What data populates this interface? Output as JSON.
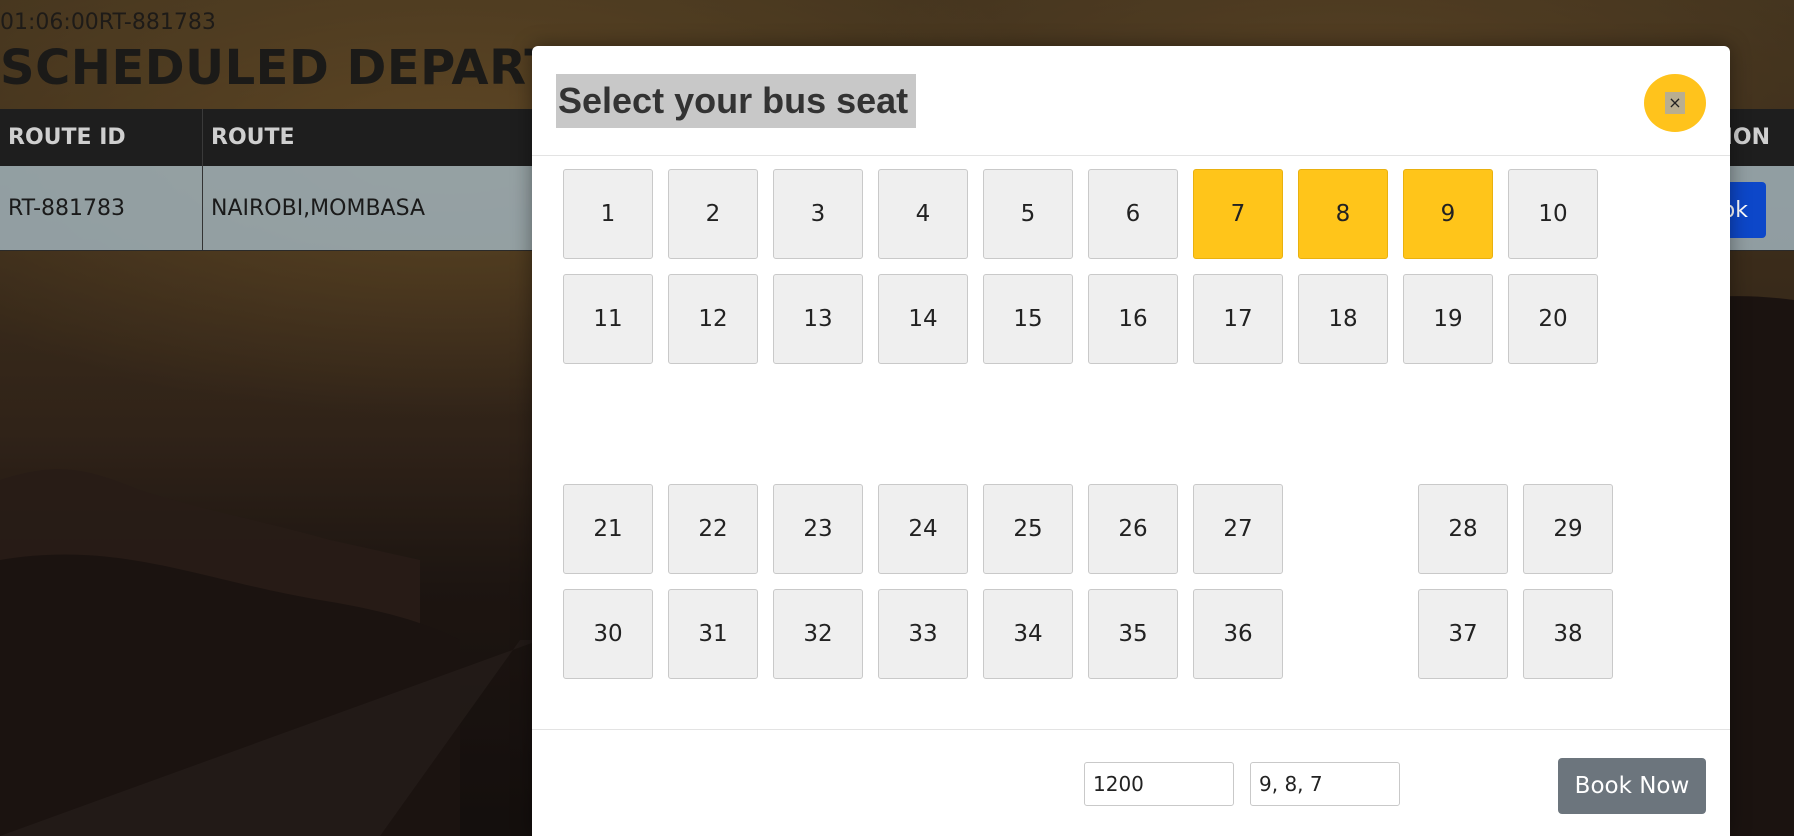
{
  "page": {
    "meta_line": "01:06:00RT-881783",
    "heading": "SCHEDULED DEPARTURES"
  },
  "table": {
    "columns": [
      "ROUTE ID",
      "ROUTE",
      "ACTION"
    ],
    "rows": [
      {
        "route_id": "RT-881783",
        "route": "NAIROBI,MOMBASA",
        "action_label": "Book"
      }
    ]
  },
  "modal": {
    "title": "Select your bus seat",
    "close_label": "×",
    "seats": [
      {
        "number": "1",
        "selected": false
      },
      {
        "number": "2",
        "selected": false
      },
      {
        "number": "3",
        "selected": false
      },
      {
        "number": "4",
        "selected": false
      },
      {
        "number": "5",
        "selected": false
      },
      {
        "number": "6",
        "selected": false
      },
      {
        "number": "7",
        "selected": true
      },
      {
        "number": "8",
        "selected": true
      },
      {
        "number": "9",
        "selected": true
      },
      {
        "number": "10",
        "selected": false
      },
      {
        "number": "11",
        "selected": false
      },
      {
        "number": "12",
        "selected": false
      },
      {
        "number": "13",
        "selected": false
      },
      {
        "number": "14",
        "selected": false
      },
      {
        "number": "15",
        "selected": false
      },
      {
        "number": "16",
        "selected": false
      },
      {
        "number": "17",
        "selected": false
      },
      {
        "number": "18",
        "selected": false
      },
      {
        "number": "19",
        "selected": false
      },
      {
        "number": "20",
        "selected": false
      },
      {
        "number": "21",
        "selected": false
      },
      {
        "number": "22",
        "selected": false
      },
      {
        "number": "23",
        "selected": false
      },
      {
        "number": "24",
        "selected": false
      },
      {
        "number": "25",
        "selected": false
      },
      {
        "number": "26",
        "selected": false
      },
      {
        "number": "27",
        "selected": false
      },
      {
        "number": "28",
        "selected": false
      },
      {
        "number": "29",
        "selected": false
      },
      {
        "number": "30",
        "selected": false
      },
      {
        "number": "31",
        "selected": false
      },
      {
        "number": "32",
        "selected": false
      },
      {
        "number": "33",
        "selected": false
      },
      {
        "number": "34",
        "selected": false
      },
      {
        "number": "35",
        "selected": false
      },
      {
        "number": "36",
        "selected": false
      },
      {
        "number": "37",
        "selected": false
      },
      {
        "number": "38",
        "selected": false
      }
    ],
    "footer": {
      "price_value": "1200",
      "selected_seats_value": "9, 8, 7",
      "book_now_label": "Book Now"
    }
  },
  "colors": {
    "selected_seat": "#ffc51a",
    "close_button": "#ffc31c",
    "book_now": "#6c757d",
    "action_button": "#0d47c9"
  }
}
